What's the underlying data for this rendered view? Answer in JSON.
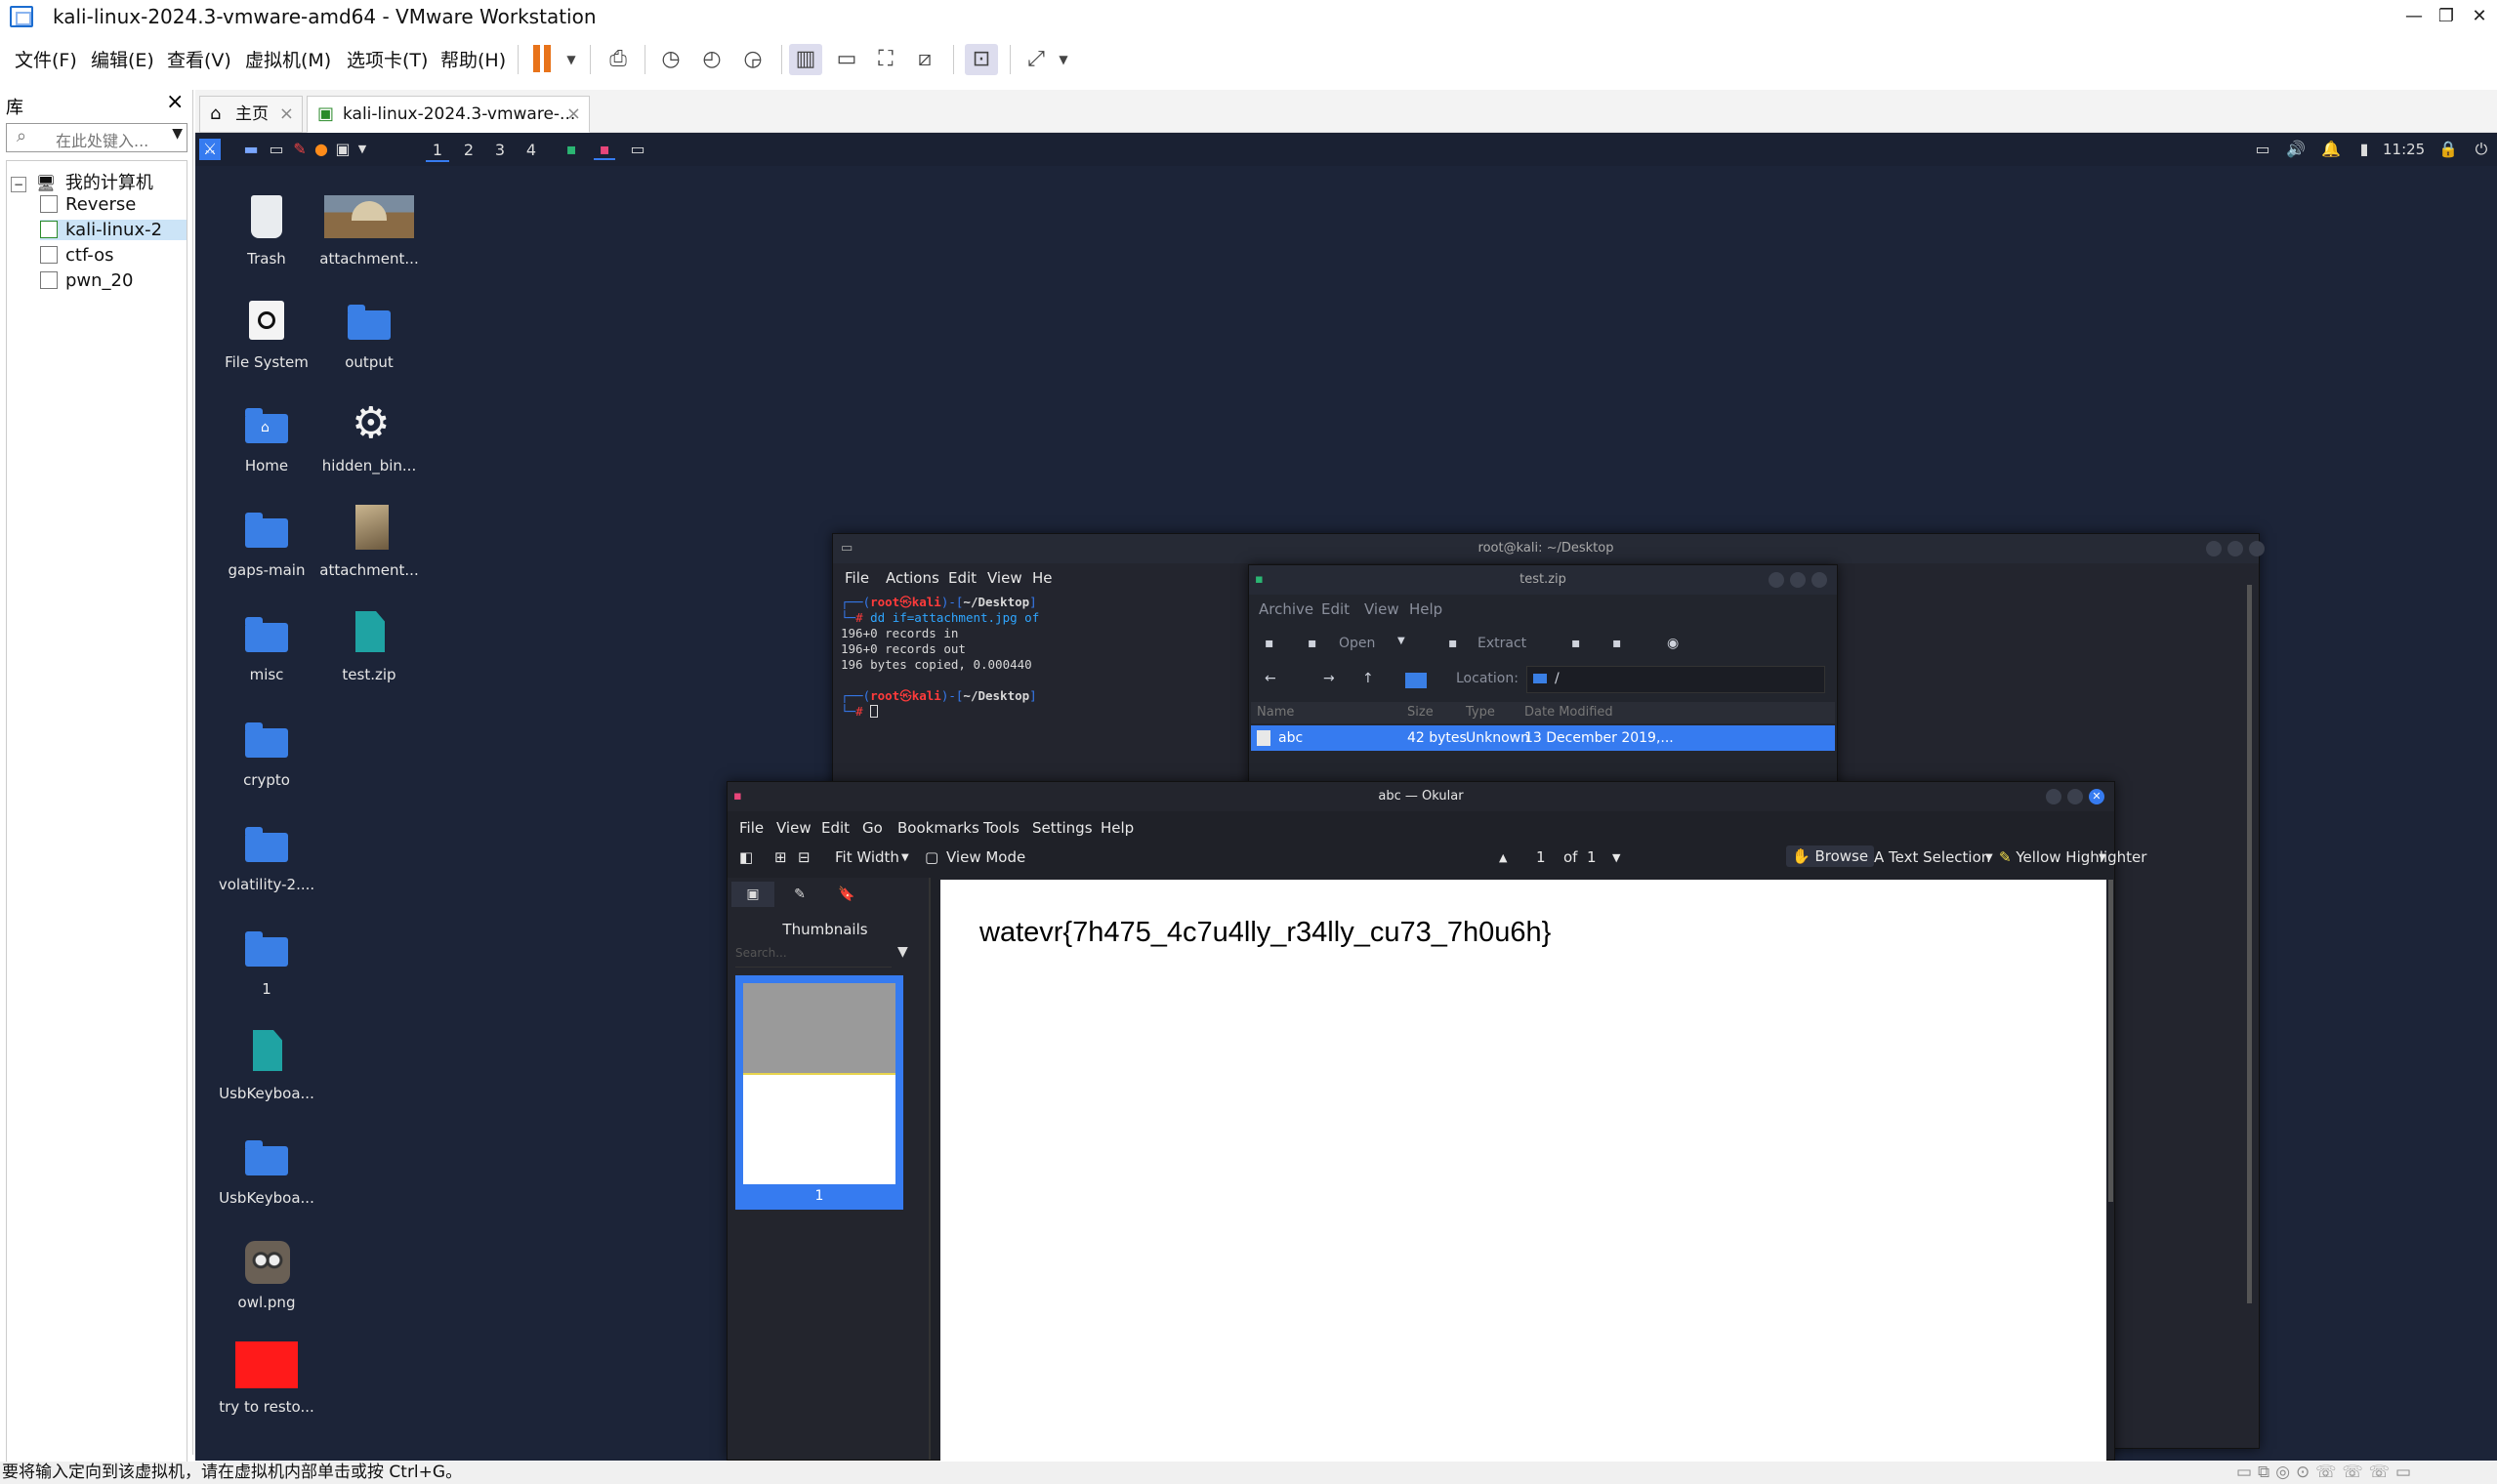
{
  "vmware": {
    "window_title": "kali-linux-2024.3-vmware-amd64 - VMware Workstation",
    "window_buttons": [
      "—",
      "❐",
      "✕"
    ],
    "menu": [
      "文件(F)",
      "编辑(E)",
      "查看(V)",
      "虚拟机(M)",
      "选项卡(T)",
      "帮助(H)"
    ],
    "tabs": [
      {
        "label": "主页",
        "active": false
      },
      {
        "label": "kali-linux-2024.3-vmware-...",
        "active": true
      }
    ],
    "library": {
      "title": "库",
      "search_placeholder": "在此处键入...",
      "root": "我的计算机",
      "items": [
        "Reverse",
        "kali-linux-2",
        "ctf-os",
        "pwn_20"
      ]
    },
    "status_bar": "要将输入定向到该虚拟机，请在虚拟机内部单击或按 Ctrl+G。",
    "accent_color": "#e8731a"
  },
  "kali": {
    "workspaces": [
      "1",
      "2",
      "3",
      "4"
    ],
    "clock": "11:25",
    "desktop_col1": [
      "Trash",
      "File System",
      "Home",
      "gaps-main",
      "misc",
      "crypto",
      "volatility-2....",
      "1",
      "UsbKeyboa...",
      "UsbKeyboa...",
      "owl.png",
      "try to resto..."
    ],
    "desktop_col2": [
      "attachment...",
      "output",
      "hidden_bin...",
      "attachment...",
      "test.zip"
    ]
  },
  "terminal": {
    "title": "root@kali: ~/Desktop",
    "menu": [
      "File",
      "Actions",
      "Edit",
      "View",
      "He"
    ],
    "prompt1_user": "root",
    "prompt1_host": "kali",
    "prompt1_dir": "~/Desktop",
    "command": "dd if=attachment.jpg of",
    "output": [
      "196+0 records in",
      "196+0 records out",
      "196 bytes copied, 0.000440"
    ],
    "prompt2_user": "root",
    "prompt2_host": "kali",
    "prompt2_dir": "~/Desktop"
  },
  "ark": {
    "title": "test.zip",
    "menu": [
      "Archive",
      "Edit",
      "View",
      "Help"
    ],
    "open_label": "Open",
    "extract_label": "Extract",
    "location_label": "Location:",
    "location_value": "/",
    "columns": [
      "Name",
      "Size",
      "Type",
      "Date Modified"
    ],
    "rows": [
      {
        "name": "abc",
        "size": "42 bytes",
        "type": "Unknown",
        "date": "13 December 2019,..."
      }
    ]
  },
  "okular": {
    "title": "abc — Okular",
    "menu": [
      "File",
      "View",
      "Edit",
      "Go",
      "Bookmarks",
      "Tools",
      "Settings",
      "Help"
    ],
    "fit_width": "Fit Width",
    "view_mode": "View Mode",
    "page_current": "1",
    "page_of": "of",
    "page_total": "1",
    "browse": "Browse",
    "text_selection": "Text Selection",
    "highlighter": "Yellow Highlighter",
    "sidebar_title": "Thumbnails",
    "search_placeholder": "Search...",
    "thumb_label": "1",
    "document_text": "watevr{7h475_4c7u4lly_r34lly_cu73_7h0u6h}"
  }
}
